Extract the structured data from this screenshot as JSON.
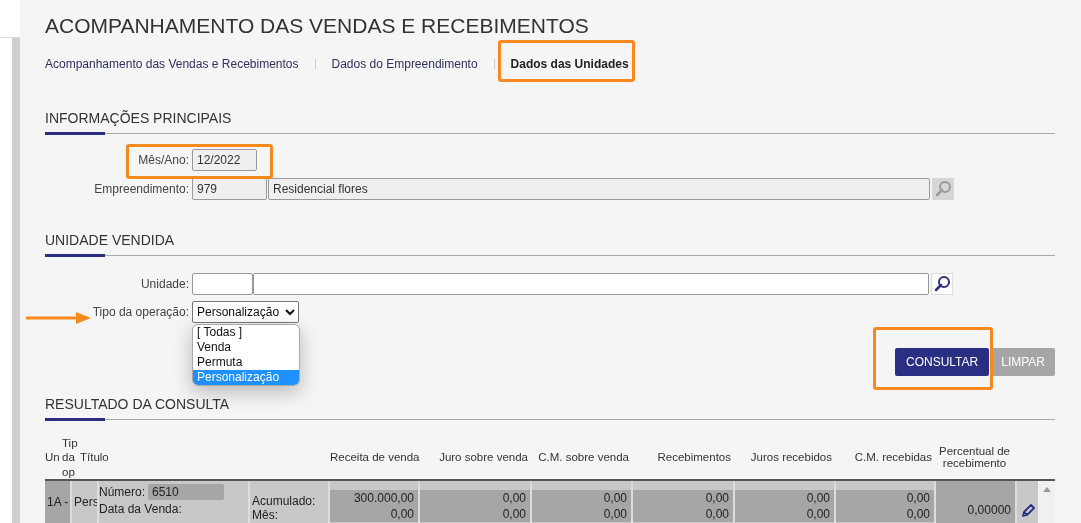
{
  "page_title": "ACOMPANHAMENTO DAS VENDAS E RECEBIMENTOS",
  "tabs": [
    {
      "label": "Acompanhamento das Vendas e Recebimentos",
      "selected": false
    },
    {
      "label": "Dados do Empreendimento",
      "selected": false
    },
    {
      "label": "Dados das Unidades",
      "selected": true
    }
  ],
  "main_info": {
    "title": "INFORMAÇÕES PRINCIPAIS",
    "fields": [
      {
        "label": "Mês/Ano:",
        "values": [
          "12/2022"
        ]
      },
      {
        "label": "Empreendimento:",
        "values": [
          "979",
          "Residencial flores"
        ]
      }
    ]
  },
  "sold_unit": {
    "title": "UNIDADE VENDIDA",
    "unit_label": "Unidade:",
    "operation": {
      "label": "Tipo da operação:",
      "value": "Personalização",
      "expanded": true,
      "options": [
        {
          "label": "[ Todas ]",
          "selected": false
        },
        {
          "label": "Venda",
          "selected": false
        },
        {
          "label": "Permuta",
          "selected": false
        },
        {
          "label": "Personalização",
          "selected": true
        }
      ]
    }
  },
  "buttons": [
    {
      "label": "CONSULTAR",
      "kind": "primary"
    },
    {
      "label": "LIMPAR",
      "kind": "secondary"
    }
  ],
  "results": {
    "title": "RESULTADO DA CONSULTA",
    "columns": [
      "Un",
      "Tip da op",
      "Título",
      "Receita de venda",
      "Juro sobre venda",
      "C.M. sobre venda",
      "Recebimentos",
      "Juros recebidos",
      "C.M. recebidas",
      "Percentual de recebimento"
    ],
    "rows": [
      {
        "unit": "1A -",
        "operation": "Pers",
        "number_label": "Número:",
        "number": "6510",
        "date_label": "Data da Venda:",
        "period_labels": [
          "Acumulado:",
          "Mês:"
        ],
        "values": [
          [
            "300.000,00",
            "0,00"
          ],
          [
            "0,00",
            "0,00"
          ],
          [
            "0,00",
            "0,00"
          ],
          [
            "0,00",
            "0,00"
          ],
          [
            "0,00",
            "0,00"
          ],
          [
            "0,00",
            "0,00"
          ]
        ],
        "percent": "0,00000"
      }
    ]
  }
}
